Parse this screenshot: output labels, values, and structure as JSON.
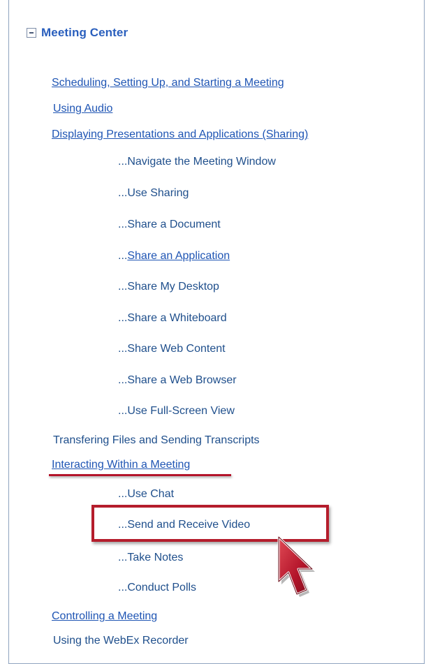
{
  "section": {
    "title": "Meeting Center",
    "toggle_icon": "collapse-minus-icon"
  },
  "topics": [
    "Scheduling, Setting Up, and Starting a Meeting",
    "Using Audio",
    "Displaying Presentations and Applications (Sharing)"
  ],
  "sharing_subitems": [
    "...Navigate the Meeting Window",
    "...Use Sharing",
    "...Share a Document",
    "...",
    "Share an Application",
    "...Share My Desktop",
    "...Share a Whiteboard",
    "...Share Web Content",
    "...Share a Web Browser",
    "...Use Full-Screen View"
  ],
  "topics_middle": [
    "Transfering Files and Sending Transcripts",
    "Interacting Within a Meeting"
  ],
  "interacting_subitems": [
    "...Use Chat",
    "...Send and Receive Video",
    "...Take Notes",
    "...Conduct Polls"
  ],
  "topics_bottom": [
    "Controlling a Meeting",
    "Using the WebEx Recorder"
  ],
  "colors": {
    "link": "#1f55b4",
    "text": "#1f4f8c",
    "highlight": "#b51d2c",
    "header": "#2a5fbd"
  },
  "cursor_icon": "arrow-pointer-icon"
}
